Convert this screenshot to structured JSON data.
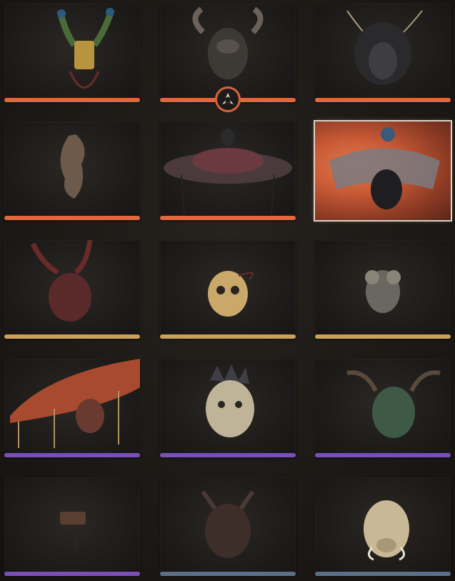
{
  "colors": {
    "orange": "#e0673e",
    "gold": "#c9a15a",
    "purple": "#7a4fb8",
    "steel": "#5b6f86"
  },
  "items": [
    {
      "name": "peacock-feather-crown-icon",
      "rarity": "orange",
      "equipped": false,
      "selected": false
    },
    {
      "name": "horned-beast-mask-icon",
      "rarity": "orange",
      "equipped": true,
      "selected": false
    },
    {
      "name": "wild-hair-mask-icon",
      "rarity": "orange",
      "equipped": false,
      "selected": false
    },
    {
      "name": "flame-shaped-ornament-icon",
      "rarity": "orange",
      "equipped": false,
      "selected": false
    },
    {
      "name": "wide-brim-hat-icon",
      "rarity": "orange",
      "equipped": false,
      "selected": false
    },
    {
      "name": "veiled-hood-icon",
      "rarity": "orange",
      "equipped": false,
      "selected": true
    },
    {
      "name": "antlered-red-mask-icon",
      "rarity": "gold",
      "equipped": false,
      "selected": false
    },
    {
      "name": "golden-skull-mask-icon",
      "rarity": "gold",
      "equipped": false,
      "selected": false
    },
    {
      "name": "cloud-beast-mask-icon",
      "rarity": "gold",
      "equipped": false,
      "selected": false
    },
    {
      "name": "mushroom-hat-icon",
      "rarity": "purple",
      "equipped": false,
      "selected": false
    },
    {
      "name": "bone-dragon-mask-icon",
      "rarity": "purple",
      "equipped": false,
      "selected": false
    },
    {
      "name": "green-horned-mask-icon",
      "rarity": "purple",
      "equipped": false,
      "selected": false
    },
    {
      "name": "cloth-headband-icon",
      "rarity": "purple",
      "equipped": false,
      "selected": false
    },
    {
      "name": "dark-demon-mask-icon",
      "rarity": "steel",
      "equipped": false,
      "selected": false
    },
    {
      "name": "boar-mask-icon",
      "rarity": "steel",
      "equipped": false,
      "selected": false
    }
  ]
}
